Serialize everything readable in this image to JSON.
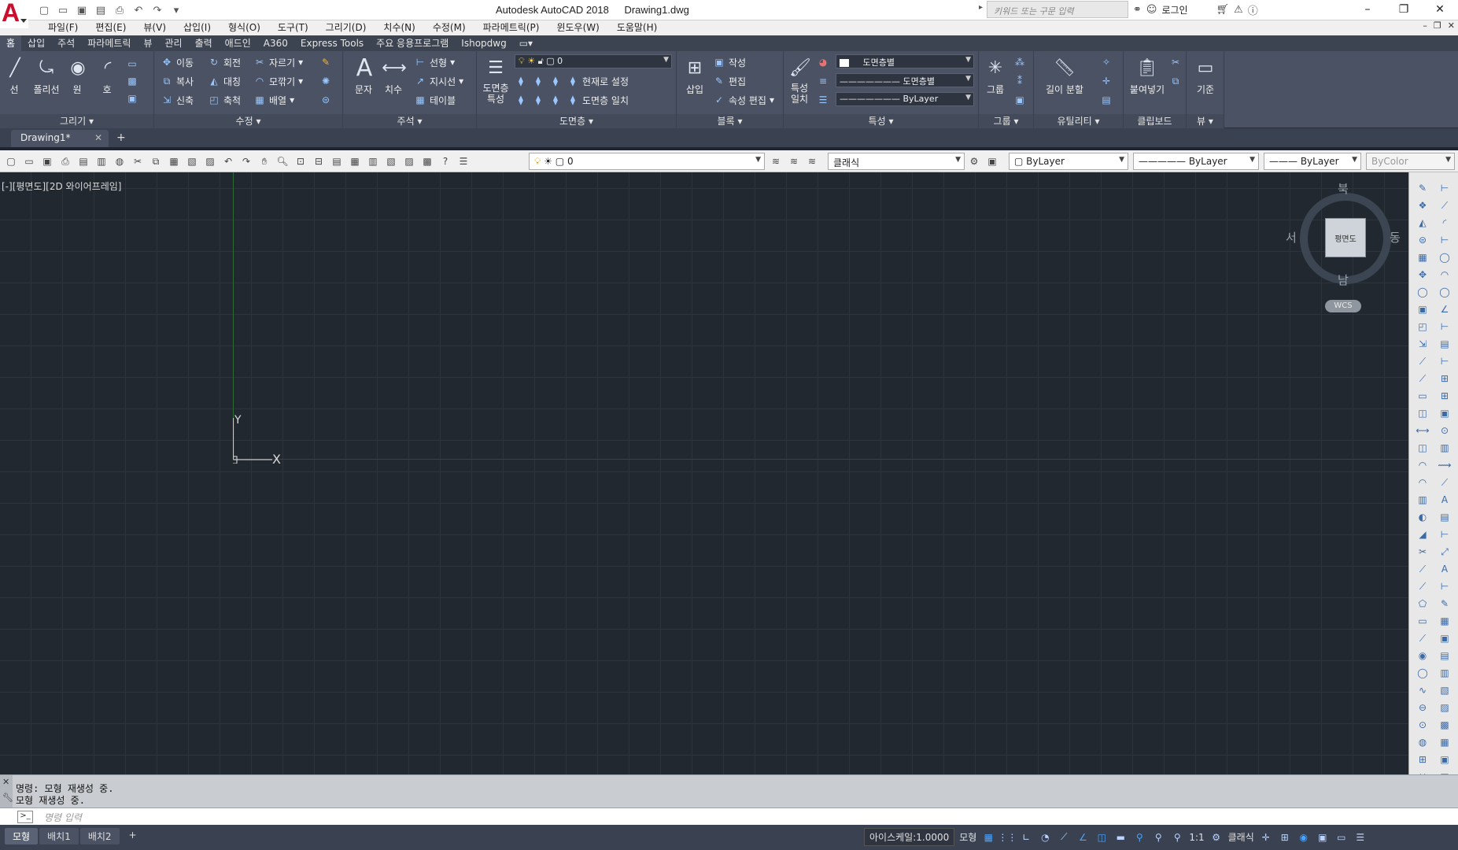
{
  "window": {
    "app_title": "Autodesk AutoCAD 2018",
    "doc_title": "Drawing1.dwg",
    "search_placeholder": "키워드 또는 구문 입력",
    "login_label": "로그인"
  },
  "menu": [
    "파일(F)",
    "편집(E)",
    "뷰(V)",
    "삽입(I)",
    "형식(O)",
    "도구(T)",
    "그리기(D)",
    "치수(N)",
    "수정(M)",
    "파라메트릭(P)",
    "윈도우(W)",
    "도움말(H)"
  ],
  "ribbon_tabs": [
    "홈",
    "삽입",
    "주석",
    "파라메트릭",
    "뷰",
    "관리",
    "출력",
    "애드인",
    "A360",
    "Express Tools",
    "주요 응용프로그램",
    "Ishopdwg"
  ],
  "ribbon": {
    "draw": {
      "title": "그리기",
      "line": "선",
      "polyline": "폴리선",
      "circle": "원",
      "arc": "호"
    },
    "modify": {
      "title": "수정",
      "move": "이동",
      "rotate": "회전",
      "trim": "자르기",
      "copy": "복사",
      "mirror": "대칭",
      "fillet": "모깎기",
      "stretch": "신축",
      "scale": "축척",
      "array": "배열"
    },
    "annotation": {
      "title": "주석",
      "text": "문자",
      "dimension": "치수",
      "linear": "선형",
      "leader": "지시선",
      "table": "테이블"
    },
    "layers": {
      "title": "도면층",
      "properties": "도면층 특성",
      "layer_value": "0",
      "make_current": "현재로 설정",
      "match": "도면층 일치"
    },
    "block": {
      "title": "블록",
      "insert": "삽입",
      "create": "작성",
      "edit": "편집",
      "edit_attr": "속성 편집"
    },
    "properties": {
      "title": "특성",
      "match": "특성 일치",
      "color": "도면층별",
      "linetype": "도면층별",
      "lineweight": "ByLayer"
    },
    "groups": {
      "title": "그룹",
      "group": "그룹"
    },
    "utilities": {
      "title": "유틸리티",
      "measure": "길이 분할"
    },
    "clipboard": {
      "title": "클립보드",
      "paste": "붙여넣기"
    },
    "view": {
      "title": "뷰",
      "base": "기준"
    }
  },
  "document_tab": "Drawing1*",
  "classic_toolbar": {
    "layer": "0",
    "workspace": "클래식",
    "color": "ByLayer",
    "linetype": "ByLayer",
    "lineweight": "ByLayer",
    "plotstyle": "ByColor"
  },
  "canvas": {
    "view_label": "[-][평면도][2D 와이어프레임]",
    "ucs_x": "X",
    "ucs_y": "Y"
  },
  "viewcube": {
    "north": "북",
    "south": "남",
    "east": "동",
    "west": "서",
    "face": "평면도",
    "wcs": "WCS"
  },
  "command": {
    "history": [
      "명령: 모형 재생성 중.",
      "모형 재생성 중."
    ],
    "placeholder": "명령 입력"
  },
  "status": {
    "layout_tabs": [
      "모형",
      "배치1",
      "배치2"
    ],
    "annoscale": "아이스케일:1.0000",
    "model": "모형",
    "scale": "1:1",
    "workspace": "클래식"
  }
}
